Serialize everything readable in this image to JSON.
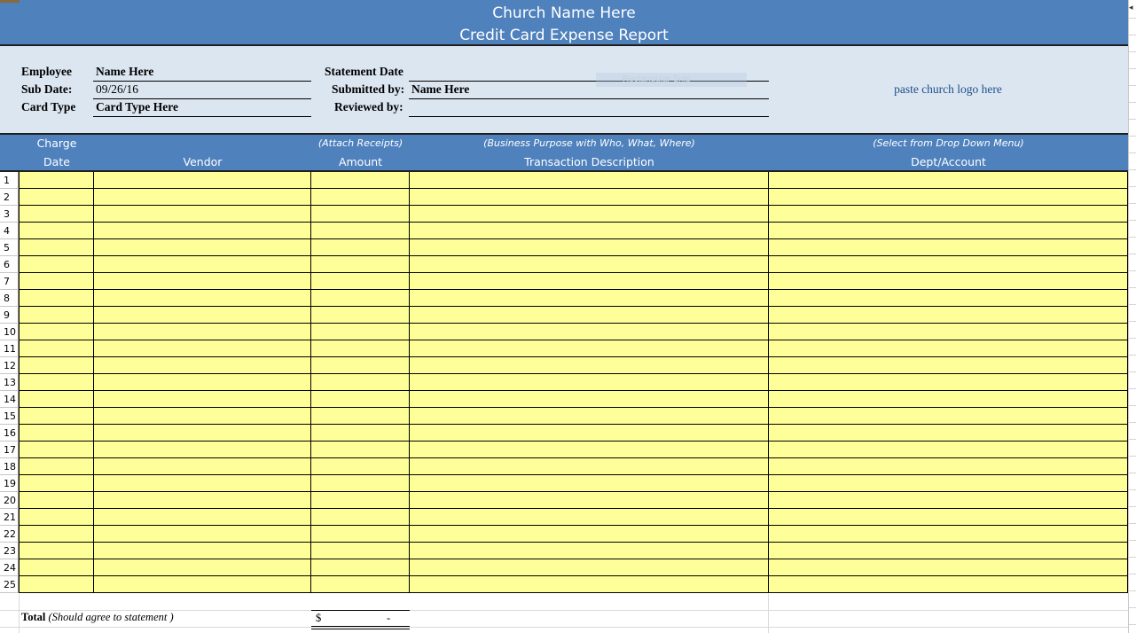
{
  "header": {
    "church_name": "Church Name Here",
    "report_title": "Credit Card Expense Report"
  },
  "info": {
    "employee_label": "Employee",
    "employee_value": "Name Here",
    "sub_date_label": "Sub Date:",
    "sub_date_value": "09/26/16",
    "card_type_label": "Card Type",
    "card_type_value": "Card Type Here",
    "statement_date_label": "Statement Date",
    "statement_date_value": "",
    "submitted_by_label": "Submitted by:",
    "submitted_by_value": "Name Here",
    "reviewed_by_label": "Reviewed by:",
    "reviewed_by_value": "",
    "logo_placeholder": "paste church logo here",
    "snip_ghost": "Rectangular Snip"
  },
  "columns": {
    "date_line1": "Charge",
    "date_line2": "Date",
    "vendor": "Vendor",
    "amount_note": "(Attach Receipts)",
    "amount": "Amount",
    "description_note": "(Business Purpose with Who, What, Where)",
    "description": "Transaction Description",
    "dept_note": "(Select from Drop Down Menu)",
    "dept": "Dept/Account"
  },
  "rows": [
    "1",
    "2",
    "3",
    "4",
    "5",
    "6",
    "7",
    "8",
    "9",
    "10",
    "11",
    "12",
    "13",
    "14",
    "15",
    "16",
    "17",
    "18",
    "19",
    "20",
    "21",
    "22",
    "23",
    "24",
    "25"
  ],
  "total": {
    "label": "Total",
    "note": "(Should agree to statement )",
    "currency": "$",
    "value": "-"
  },
  "colors": {
    "header_blue": "#4f81bd",
    "info_band": "#dce6f1",
    "entry_cell": "#ffff99",
    "logo_text": "#1f4e8c"
  }
}
